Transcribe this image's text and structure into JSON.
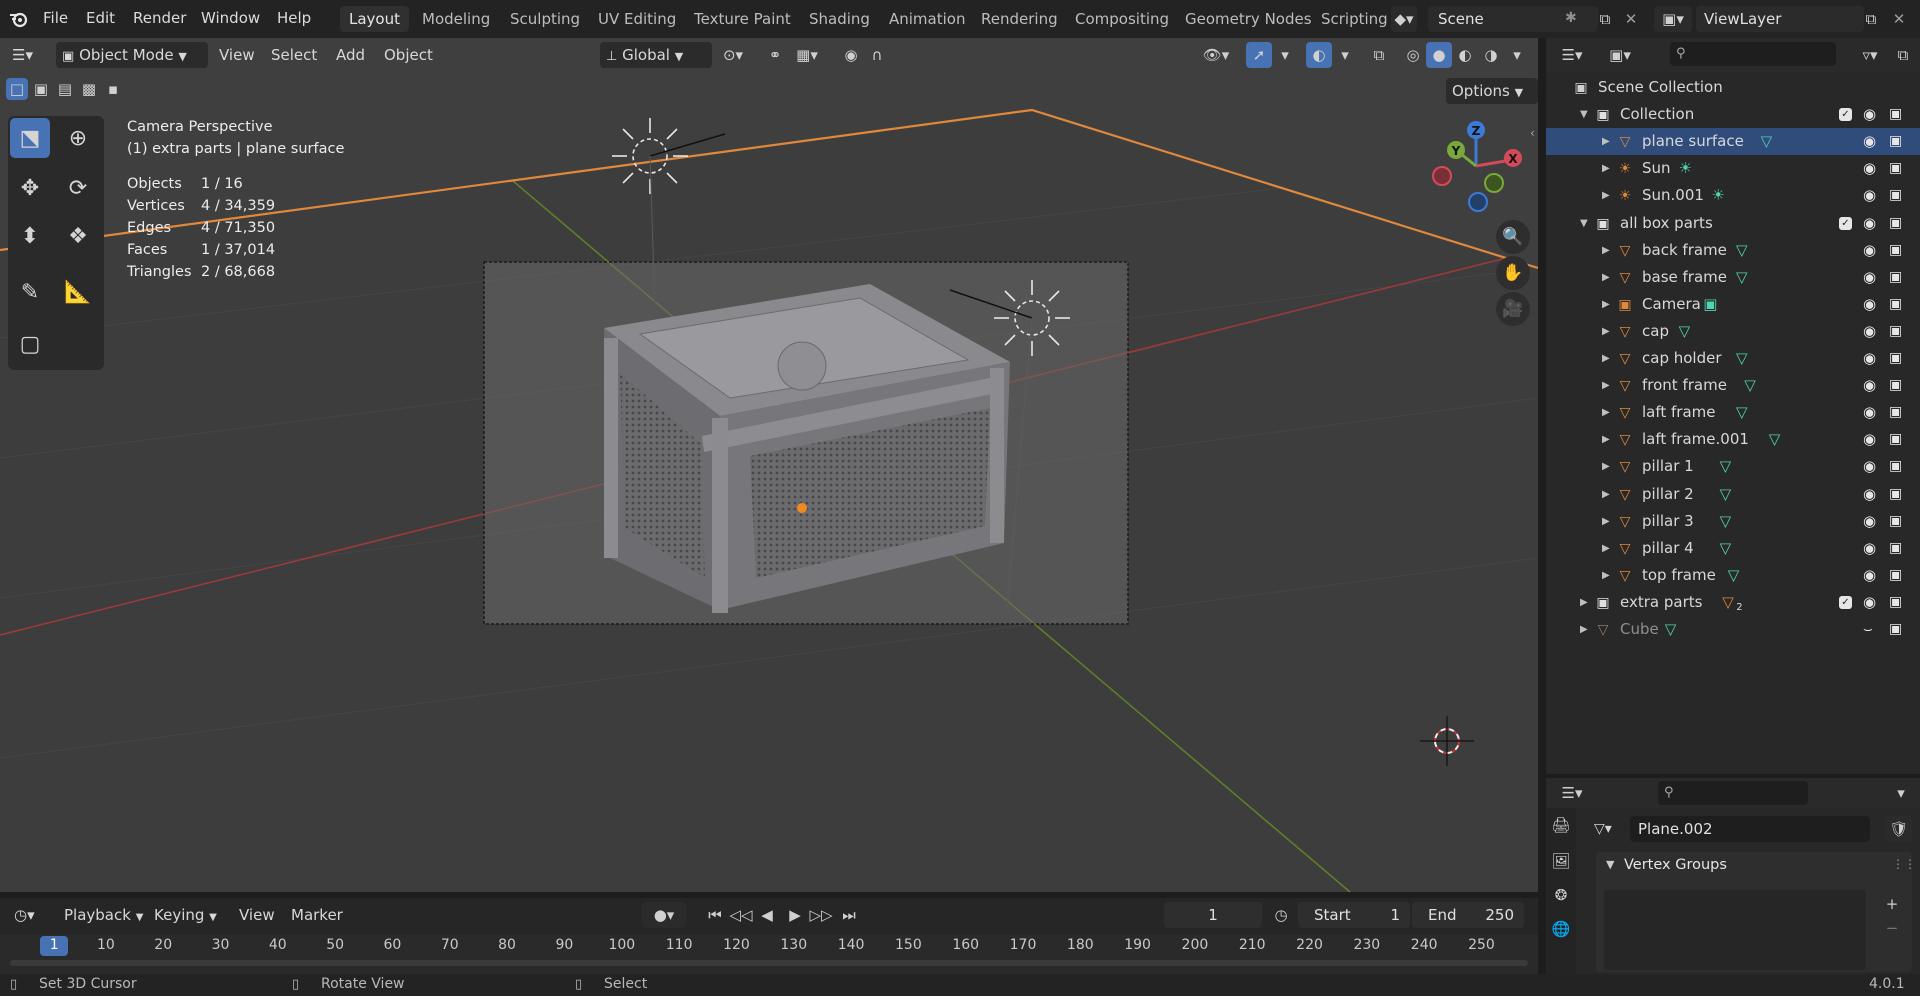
{
  "menu": {
    "items": [
      "File",
      "Edit",
      "Render",
      "Window",
      "Help"
    ]
  },
  "workspaces": [
    "Layout",
    "Modeling",
    "Sculpting",
    "UV Editing",
    "Texture Paint",
    "Shading",
    "Animation",
    "Rendering",
    "Compositing",
    "Geometry Nodes",
    "Scripting"
  ],
  "active_workspace": "Layout",
  "scene": {
    "name": "Scene",
    "view_layer": "ViewLayer"
  },
  "viewport_header": {
    "mode": "Object Mode",
    "menus": [
      "View",
      "Select",
      "Add",
      "Object"
    ],
    "transform_orientation": "Global",
    "options_label": "Options"
  },
  "overlay_text": {
    "view_name": "Camera Perspective",
    "context": "(1) extra parts | plane surface",
    "stats": [
      {
        "label": "Objects",
        "value": "1 / 16"
      },
      {
        "label": "Vertices",
        "value": "4 / 34,359"
      },
      {
        "label": "Edges",
        "value": "4 / 71,350"
      },
      {
        "label": "Faces",
        "value": "1 / 37,014"
      },
      {
        "label": "Triangles",
        "value": "2 / 68,668"
      }
    ]
  },
  "gizmo": {
    "x": "X",
    "y": "Y",
    "z": "Z"
  },
  "outliner": {
    "search_placeholder": "",
    "rows": [
      {
        "name": "Scene Collection",
        "type": "scene",
        "indent": 0
      },
      {
        "name": "Collection",
        "type": "collection",
        "indent": 1,
        "expanded": true
      },
      {
        "name": "plane surface",
        "type": "mesh",
        "indent": 2,
        "selected": true
      },
      {
        "name": "Sun",
        "type": "light",
        "indent": 2
      },
      {
        "name": "Sun.001",
        "type": "light",
        "indent": 2
      },
      {
        "name": "all box parts",
        "type": "collection",
        "indent": 1,
        "expanded": true
      },
      {
        "name": "back frame",
        "type": "mesh",
        "indent": 2
      },
      {
        "name": "base frame",
        "type": "mesh",
        "indent": 2
      },
      {
        "name": "Camera",
        "type": "camera",
        "indent": 2
      },
      {
        "name": "cap",
        "type": "mesh",
        "indent": 2
      },
      {
        "name": "cap holder",
        "type": "mesh",
        "indent": 2
      },
      {
        "name": "front frame",
        "type": "mesh",
        "indent": 2
      },
      {
        "name": "laft frame",
        "type": "mesh",
        "indent": 2
      },
      {
        "name": "laft frame.001",
        "type": "mesh",
        "indent": 2
      },
      {
        "name": "pillar 1",
        "type": "mesh",
        "indent": 2
      },
      {
        "name": "pillar 2",
        "type": "mesh",
        "indent": 2
      },
      {
        "name": "pillar 3",
        "type": "mesh",
        "indent": 2
      },
      {
        "name": "pillar 4",
        "type": "mesh",
        "indent": 2
      },
      {
        "name": "top frame",
        "type": "mesh",
        "indent": 2
      },
      {
        "name": "extra parts",
        "type": "collection",
        "indent": 1,
        "count": "2"
      },
      {
        "name": "Cube",
        "type": "mesh-hidden",
        "indent": 1
      }
    ]
  },
  "properties": {
    "mesh_name": "Plane.002",
    "panel_title": "Vertex Groups"
  },
  "timeline": {
    "menus": [
      "Playback",
      "Keying",
      "View",
      "Marker"
    ],
    "current_frame": "1",
    "start_label": "Start",
    "start": "1",
    "end_label": "End",
    "end": "250",
    "ticks": [
      "1",
      "10",
      "20",
      "30",
      "40",
      "50",
      "60",
      "70",
      "80",
      "90",
      "100",
      "110",
      "120",
      "130",
      "140",
      "150",
      "160",
      "170",
      "180",
      "190",
      "200",
      "210",
      "220",
      "230",
      "240",
      "250"
    ]
  },
  "statusbar": {
    "hint1": "Set 3D Cursor",
    "hint2": "Rotate View",
    "hint3": "Select",
    "version": "4.0.1"
  },
  "colors": {
    "accent": "#4772b3",
    "selection_row": "#2f4c7a",
    "object_orange": "#e0883c",
    "mesh_data": "#4fd3b1"
  }
}
